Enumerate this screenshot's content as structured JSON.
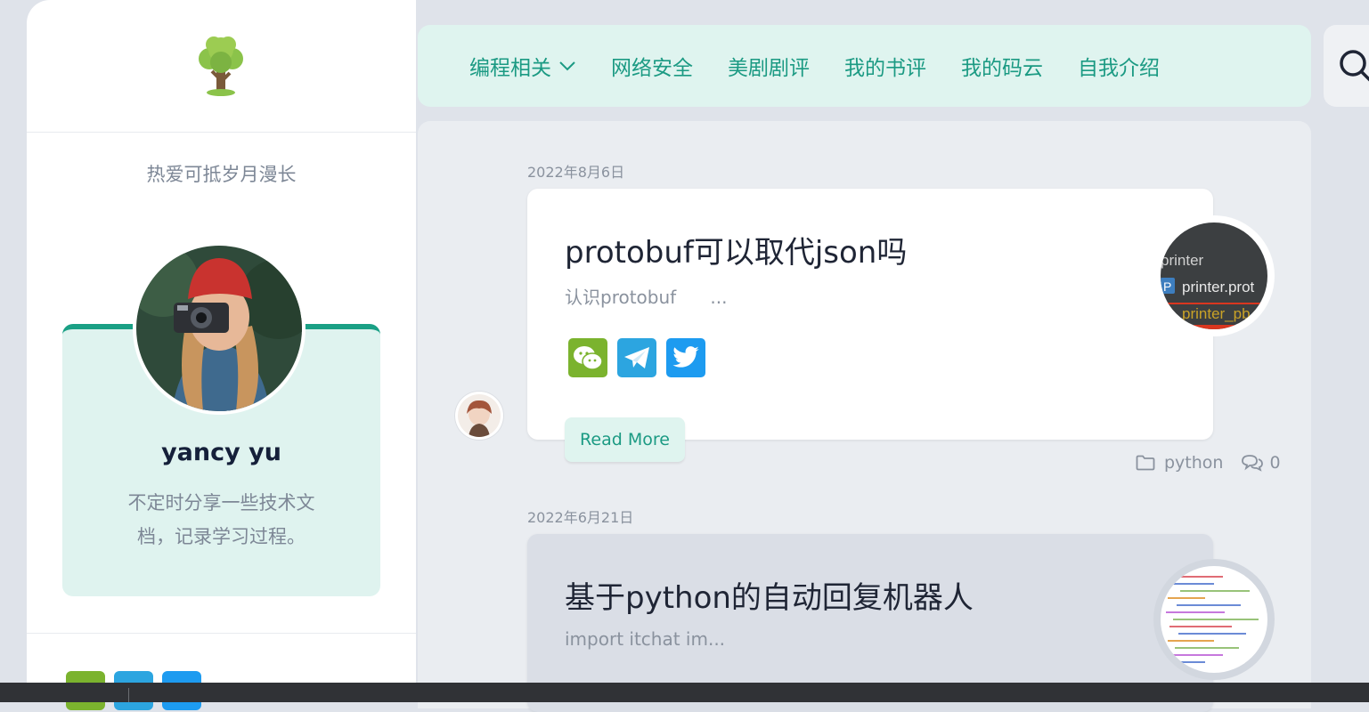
{
  "nav": {
    "items": [
      "编程相关",
      "网络安全",
      "美剧剧评",
      "我的书评",
      "我的码云",
      "自我介绍"
    ],
    "dropdown_icon": "chevron-down-icon",
    "search_icon": "search-icon"
  },
  "sidebar": {
    "tagline": "热爱可抵岁月漫长",
    "profile": {
      "name": "yancy yu",
      "description": "不定时分享一些技术文档，记录学习过程。"
    }
  },
  "posts": [
    {
      "date": "2022年8月6日",
      "title": "protobuf可以取代json吗",
      "excerpt": "认识protobuf      ...",
      "read_more": "Read More",
      "category": "python",
      "comments": "0",
      "thumb_text": [
        "printer",
        "printer.prot",
        "printer_pb"
      ]
    },
    {
      "date": "2022年6月21日",
      "title": "基于python的自动回复机器人",
      "excerpt": "import itchat im..."
    }
  ],
  "colors": {
    "accent": "#1b9a83",
    "nav_bg": "#dff4ef",
    "wechat": "#7bb32e",
    "telegram": "#2ca5e0",
    "twitter": "#1d9bf0"
  }
}
